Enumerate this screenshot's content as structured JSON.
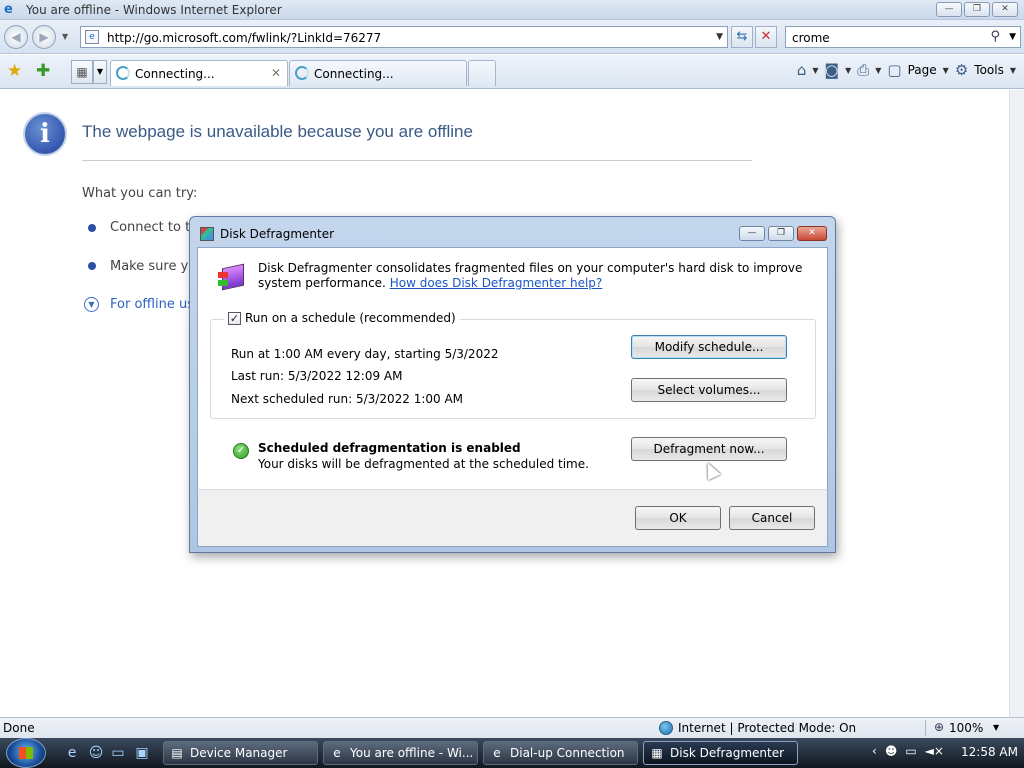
{
  "ie": {
    "title": "You are offline - Windows Internet Explorer",
    "address": "http://go.microsoft.com/fwlink/?LinkId=76277",
    "search_value": "crome",
    "tabs": [
      {
        "label": "Connecting..."
      },
      {
        "label": "Connecting..."
      }
    ],
    "cmd": {
      "page_label": "Page",
      "tools_label": "Tools"
    }
  },
  "page": {
    "title": "The webpage is unavailable because you are offline",
    "what_you_can_try": "What you can try:",
    "bullets": [
      {
        "text": "Connect to th"
      },
      {
        "text": "Make sure yo"
      }
    ],
    "offline_link": "For offline us"
  },
  "dialog": {
    "title": "Disk Defragmenter",
    "description": "Disk Defragmenter consolidates fragmented files on your computer's hard disk to improve system performance.",
    "help_link": "How does Disk Defragmenter help?",
    "schedule_checkbox_label": "Run on a schedule (recommended)",
    "schedule_checked": true,
    "run_at": "Run at 1:00 AM every day, starting 5/3/2022",
    "last_run": "Last run: 5/3/2022 12:09 AM",
    "next_run": "Next scheduled run: 5/3/2022 1:00 AM",
    "modify_schedule": "Modify schedule...",
    "select_volumes": "Select volumes...",
    "status_heading": "Scheduled defragmentation is enabled",
    "status_sub": "Your disks will be defragmented at the scheduled time.",
    "defrag_now": "Defragment now...",
    "ok": "OK",
    "cancel": "Cancel"
  },
  "statusbar": {
    "left": "Done",
    "zone": "Internet | Protected Mode: On",
    "zoom": "100%"
  },
  "taskbar": {
    "tasks": [
      {
        "label": "Device Manager"
      },
      {
        "label": "You are offline - Wi..."
      },
      {
        "label": "Dial-up Connection"
      },
      {
        "label": "Disk Defragmenter"
      }
    ],
    "clock": "12:58 AM"
  }
}
